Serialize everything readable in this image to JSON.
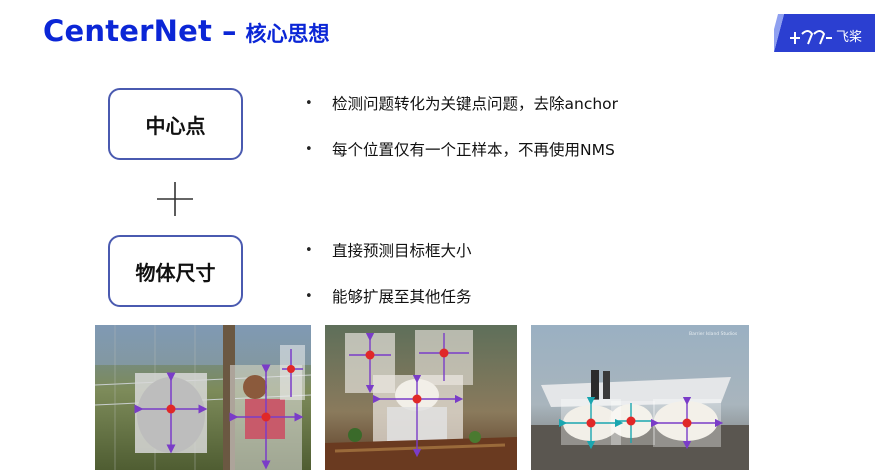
{
  "header": {
    "title_main": "CenterNet",
    "title_dash": "–",
    "title_sub": "核心思想",
    "logo_text": "飞桨"
  },
  "concepts": {
    "center_label": "中心点",
    "plus_icon": "plus-icon",
    "size_label": "物体尺寸"
  },
  "bullets_group1": [
    "检测问题转化为关键点问题，去除anchor",
    "每个位置仅有一个正样本，不再使用NMS"
  ],
  "bullets_group2": [
    "直接预测目标框大小",
    "能够扩展至其他任务"
  ],
  "images": {
    "image3_watermark": "Barrier Island Studios"
  },
  "colors": {
    "title_blue": "#0b26d6",
    "box_border": "#4a5ab0",
    "center_dot": "#e02828",
    "arrow_purple": "#7a3cc8",
    "arrow_teal": "#1aa6b0",
    "logo_blue": "#2b3fd1"
  }
}
